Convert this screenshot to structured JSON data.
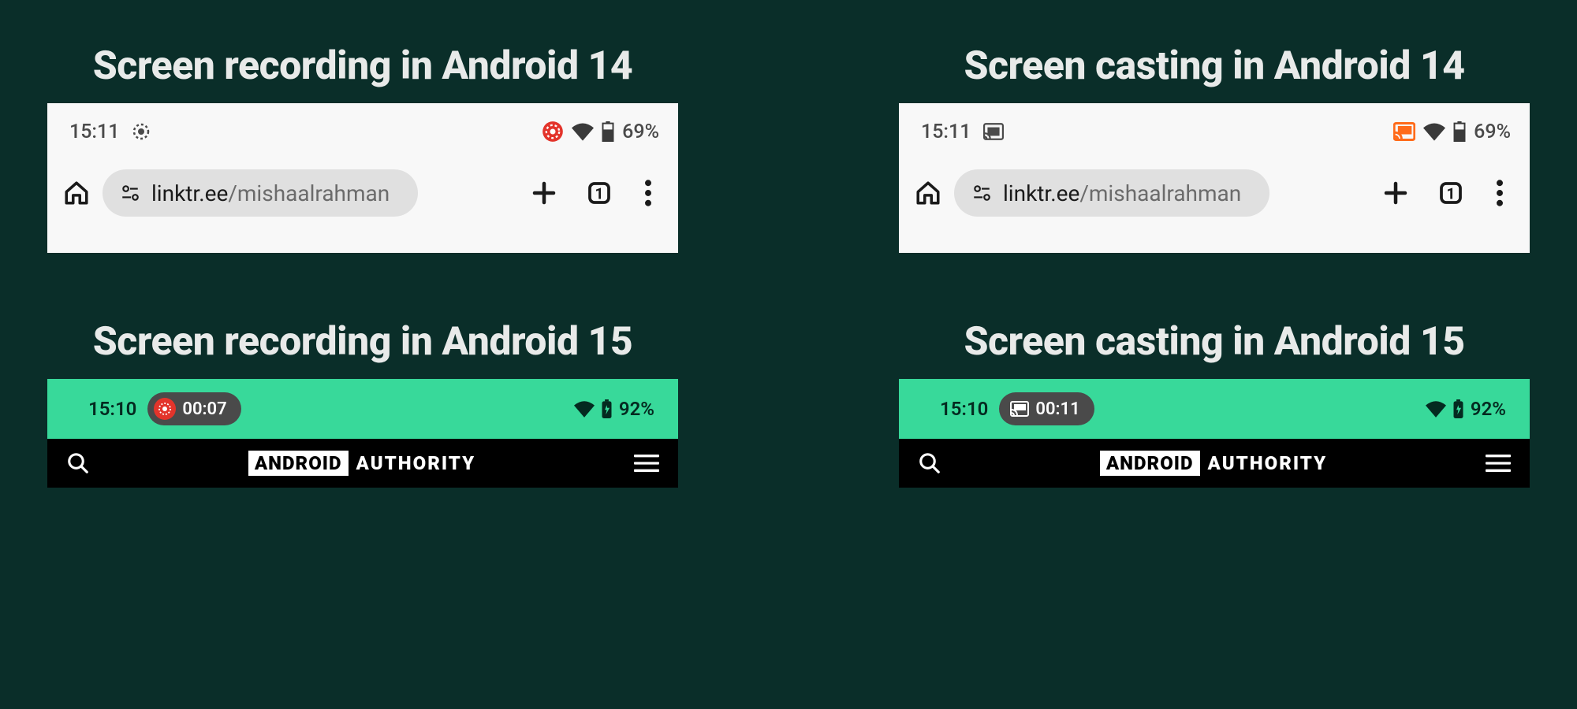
{
  "panels": {
    "recording14": {
      "title": "Screen recording in Android 14",
      "time": "15:11",
      "battery": "69%",
      "url_host": "linktr.ee",
      "url_path": "/mishaalrahman",
      "tab_count": "1"
    },
    "casting14": {
      "title": "Screen casting in Android 14",
      "time": "15:11",
      "battery": "69%",
      "url_host": "linktr.ee",
      "url_path": "/mishaalrahman",
      "tab_count": "1"
    },
    "recording15": {
      "title": "Screen recording in Android 15",
      "time": "15:10",
      "chip_time": "00:07",
      "battery": "92%",
      "brand_box": "ANDROID",
      "brand_text": "AUTHORITY"
    },
    "casting15": {
      "title": "Screen casting in Android 15",
      "time": "15:10",
      "chip_time": "00:11",
      "battery": "92%",
      "brand_box": "ANDROID",
      "brand_text": "AUTHORITY"
    }
  },
  "colors": {
    "bg": "#0a2e29",
    "accent14_record": "#e3342b",
    "accent14_cast": "#ff6b1a",
    "green15": "#38d99a"
  }
}
